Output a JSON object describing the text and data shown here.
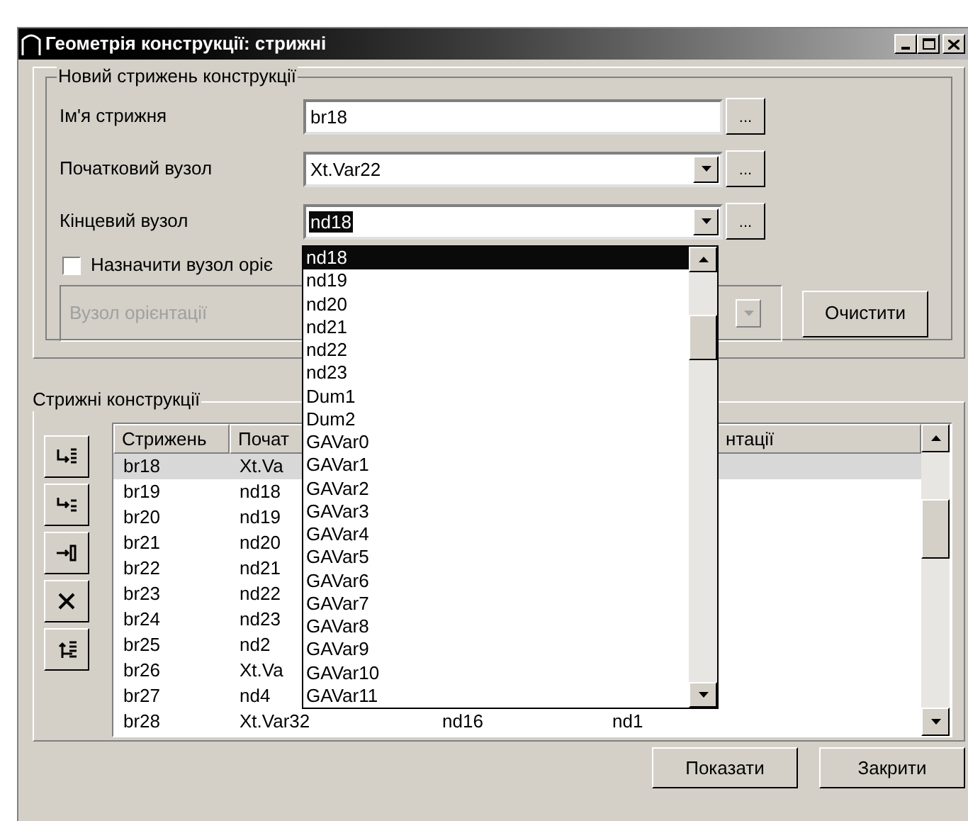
{
  "window": {
    "title": "Геометрія конструкції: стрижні"
  },
  "new_rod_group": {
    "title": "Новий стрижень конструкції",
    "fields": [
      {
        "label": "Ім'я стрижня",
        "kind": "text",
        "value": "br18",
        "browse": "..."
      },
      {
        "label": "Початковий вузол",
        "kind": "combo",
        "value": "Xt.Var22",
        "browse": "..."
      },
      {
        "label": "Кінцевий вузол",
        "kind": "combo",
        "value": "nd18",
        "text_selected": true,
        "browse": "..."
      }
    ],
    "orientation_checkbox": {
      "label": "Назначити вузол оріє",
      "checked": false
    },
    "orientation_field": {
      "value": "Вузол орієнтації",
      "disabled": true
    },
    "clear_button": "Очистити"
  },
  "dropdown": {
    "items": [
      {
        "label": "nd18",
        "selected": true
      },
      {
        "label": "nd19",
        "selected": false
      },
      {
        "label": "nd20",
        "selected": false
      },
      {
        "label": "nd21",
        "selected": false
      },
      {
        "label": "nd22",
        "selected": false
      },
      {
        "label": "nd23",
        "selected": false
      },
      {
        "label": "Dum1",
        "selected": false
      },
      {
        "label": "Dum2",
        "selected": false
      },
      {
        "label": "GAVar0",
        "selected": false
      },
      {
        "label": "GAVar1",
        "selected": false
      },
      {
        "label": "GAVar2",
        "selected": false
      },
      {
        "label": "GAVar3",
        "selected": false
      },
      {
        "label": "GAVar4",
        "selected": false
      },
      {
        "label": "GAVar5",
        "selected": false
      },
      {
        "label": "GAVar6",
        "selected": false
      },
      {
        "label": "GAVar7",
        "selected": false
      },
      {
        "label": "GAVar8",
        "selected": false
      },
      {
        "label": "GAVar9",
        "selected": false
      },
      {
        "label": "GAVar10",
        "selected": false
      },
      {
        "label": "GAVar11",
        "selected": false
      }
    ]
  },
  "rods_group": {
    "title": "Стрижні конструкції",
    "table": {
      "columns": [
        "Стрижень",
        "Почат",
        "нтації"
      ],
      "rows": [
        {
          "selected": true,
          "cells": [
            "br18",
            "Xt.Va"
          ]
        },
        {
          "selected": false,
          "cells": [
            "br19",
            "nd18"
          ]
        },
        {
          "selected": false,
          "cells": [
            "br20",
            "nd19"
          ]
        },
        {
          "selected": false,
          "cells": [
            "br21",
            "nd20"
          ]
        },
        {
          "selected": false,
          "cells": [
            "br22",
            "nd21"
          ]
        },
        {
          "selected": false,
          "cells": [
            "br23",
            "nd22"
          ]
        },
        {
          "selected": false,
          "cells": [
            "br24",
            "nd23"
          ]
        },
        {
          "selected": false,
          "cells": [
            "br25",
            "nd2"
          ]
        },
        {
          "selected": false,
          "cells": [
            "br26",
            "Xt.Va"
          ]
        },
        {
          "selected": false,
          "cells": [
            "br27",
            "nd4"
          ]
        },
        {
          "selected": false,
          "cells": [
            "br28",
            "Xt.Var32",
            "nd16",
            "nd1"
          ]
        }
      ]
    }
  },
  "buttons": [
    "Показати",
    "Закрити"
  ]
}
